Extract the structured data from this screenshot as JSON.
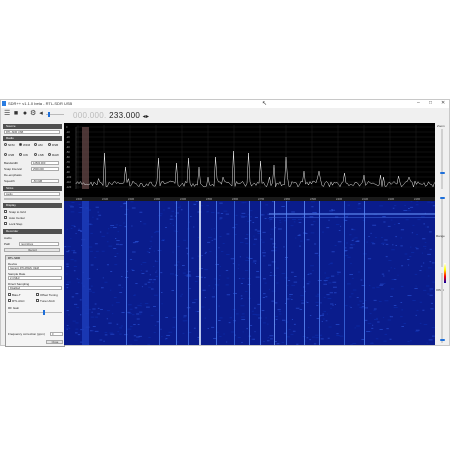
{
  "window": {
    "title": "SDR++ v1.1.0 beta - RTL-SDR USB",
    "controls": {
      "minimize": "–",
      "maximize": "□",
      "close": "✕"
    }
  },
  "toolbar": {
    "icons": [
      "menu-icon",
      "play-icon",
      "record-icon",
      "settings-icon",
      "volume-icon"
    ],
    "freq_dim": "000.000.",
    "freq_bright": "233.000",
    "arrows": "◂▸"
  },
  "sidebar": {
    "source_header": "Source",
    "source_value": "RTL-SDR USB",
    "radio_header": "Radio",
    "modes_row1": [
      "NFM",
      "WFM",
      "AM",
      "DSB"
    ],
    "modes_row2": [
      "USB",
      "CW",
      "LSB",
      "RAW"
    ],
    "bandwidth_label": "Bandwidth",
    "bandwidth_value": "12500.000",
    "snap_label": "Snap Interval",
    "snap_value": "2500.000",
    "deemph_label": "De-emphasis",
    "squelch_label": "Squelch",
    "squelch_value": "-50.0dB",
    "sink_header": "Sinks",
    "sink_value": "Audio",
    "display_header": "Display",
    "scan_labels": [
      "Snap to Grid",
      "Auto Center",
      "Lock Step"
    ],
    "recorder_label": "Recorder",
    "recorder_value": "Audio",
    "path_label": "Path",
    "path_value": "recordings",
    "record_button": "Record",
    "float_title": "RTL-SDR",
    "float_device_label": "Device",
    "float_device_value": "Generic RTL2832U OEM",
    "float_sample_label": "Sample Rate",
    "float_sample_value": "2.4 MHz",
    "float_direct_label": "Direct Sampling",
    "float_direct_value": "Disabled",
    "float_options": [
      "Bias-T",
      "Offset Tuning",
      "RTL AGC",
      "Tuner AGC"
    ],
    "float_gain_label": "RF Gain",
    "float_ppm_label": "Frequency correction (ppm)",
    "float_ppm_value": "0",
    "float_close": "Close"
  },
  "spectrum": {
    "db_labels": [
      "0",
      "-10",
      "-20",
      "-30",
      "-40",
      "-50",
      "-60",
      "-70",
      "-80",
      "-90",
      "-100",
      "-110",
      "-120"
    ],
    "freq_labels": [
      "230M",
      "231M",
      "232M",
      "233M",
      "234M",
      "235M",
      "236M",
      "237M",
      "238M",
      "239M",
      "240M",
      "241M",
      "242M",
      "243M"
    ]
  },
  "rightbar": {
    "zoom_label": "Zoom",
    "range_label": "Range",
    "offset_label": "Offset"
  },
  "colors": {
    "waterfall_bg": "#0a1c8c",
    "accent": "#1e6fd9"
  }
}
